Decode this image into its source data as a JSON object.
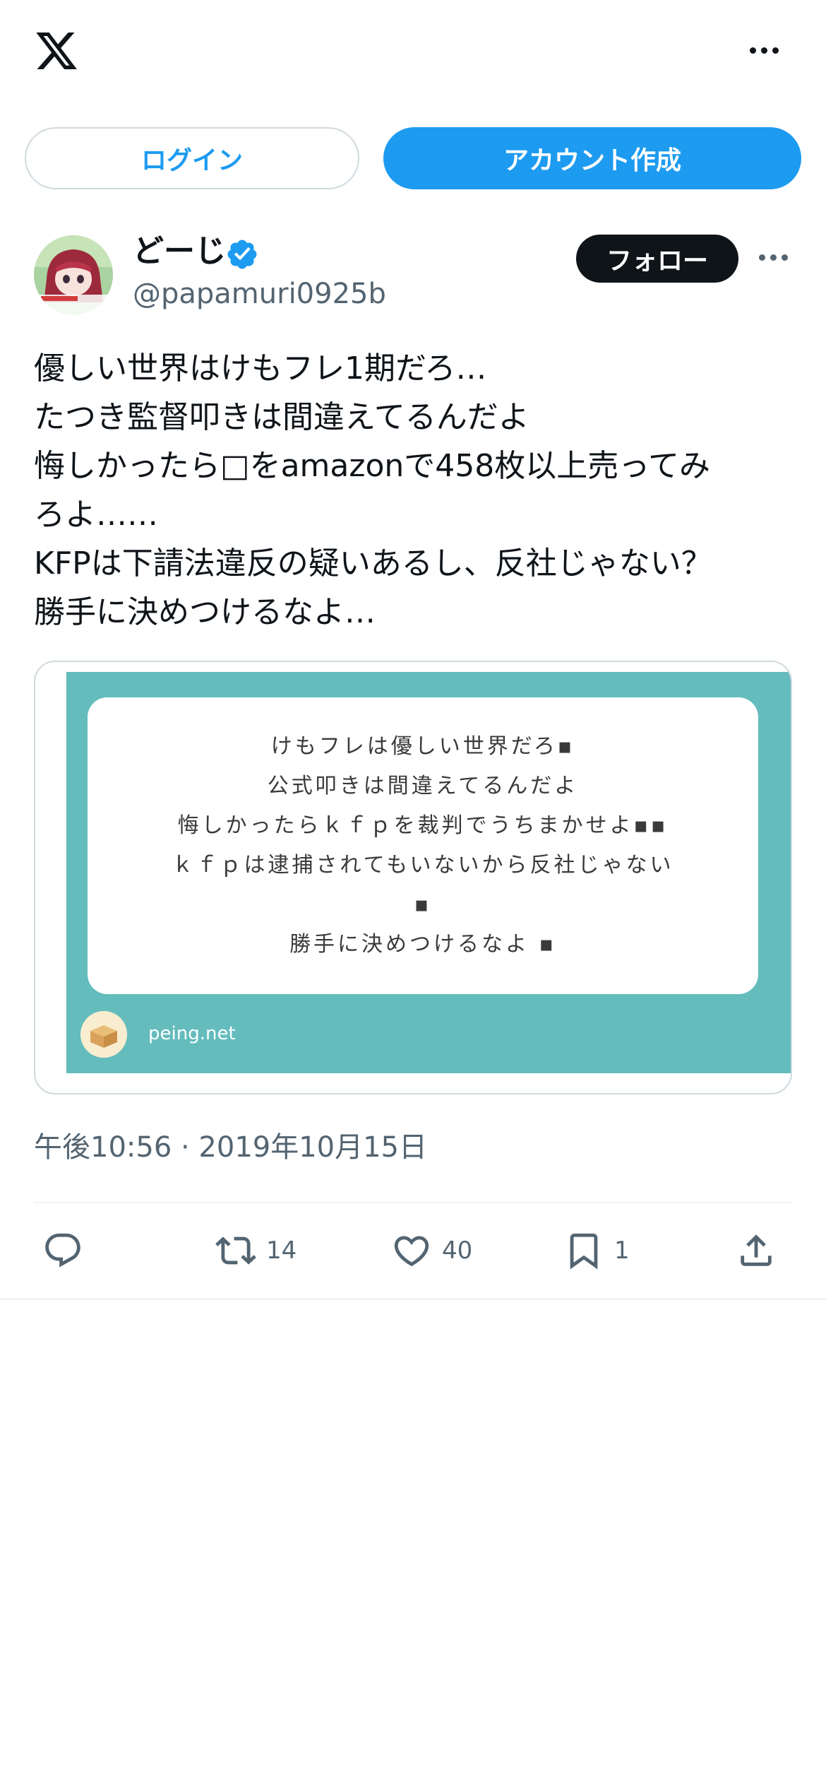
{
  "header": {
    "logo_icon": "x-logo-icon",
    "more_icon": "more-horizontal-icon"
  },
  "auth": {
    "login_label": "ログイン",
    "signup_label": "アカウント作成"
  },
  "tweet": {
    "author": {
      "display_name": "どーじ",
      "handle": "@papamuri0925b",
      "verified_icon": "verified-badge-icon",
      "follow_label": "フォロー"
    },
    "text_lines": [
      "優しい世界はけもフレ1期だろ…",
      "たつき監督叩きは間違えてるんだよ",
      "悔しかったら□をamazonで458枚以上売ってみ",
      "ろよ……",
      "KFPは下請法違反の疑いあるし、反社じゃない？",
      "勝手に決めつけるなよ…"
    ],
    "media": {
      "question_lines": [
        "けもフレは優しい世界だろ▪",
        "公式叩きは間違えてるんだよ",
        "悔しかったらｋｆｐを裁判でうちまかせよ▪▪",
        "ｋｆｐは逮捕されてもいないから反社じゃない",
        "▪",
        "勝手に決めつけるなよ ▪"
      ],
      "site": "peing.net",
      "background_color": "#64bcbd"
    },
    "timestamp": "午後10:56 · 2019年10月15日",
    "actions": {
      "reply_icon": "reply-icon",
      "retweet_icon": "retweet-icon",
      "retweet_count": "14",
      "like_icon": "heart-icon",
      "like_count": "40",
      "bookmark_icon": "bookmark-icon",
      "bookmark_count": "1",
      "share_icon": "share-icon"
    }
  },
  "colors": {
    "accent": "#1d9bf0",
    "text": "#0f1419",
    "muted": "#536471",
    "border": "#cfd9de"
  }
}
